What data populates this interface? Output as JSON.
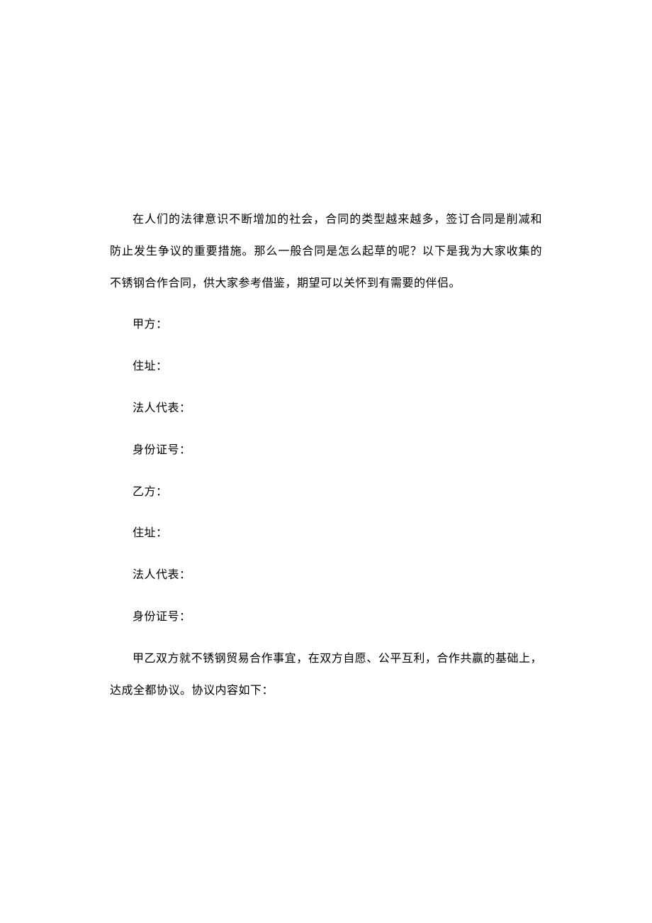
{
  "intro": "在人们的法律意识不断增加的社会，合同的类型越来越多，签订合同是削减和 防止发生争议的重要措施。那么一般合同是怎么起草的呢？以下是我为大家收集的 不锈钢合作合同，供大家参考借鉴，期望可以关怀到有需要的伴侣。",
  "partyA": {
    "label": "甲方：",
    "address": "住址：",
    "legalRep": "法人代表：",
    "idNumber": "身份证号："
  },
  "partyB": {
    "label": "乙方：",
    "address": "住址：",
    "legalRep": "法人代表：",
    "idNumber": "身份证号："
  },
  "agreement": "甲乙双方就不锈钢贸易合作事宜，在双方自愿、公平互利，合作共赢的基础上， 达成全都协议。协议内容如下："
}
